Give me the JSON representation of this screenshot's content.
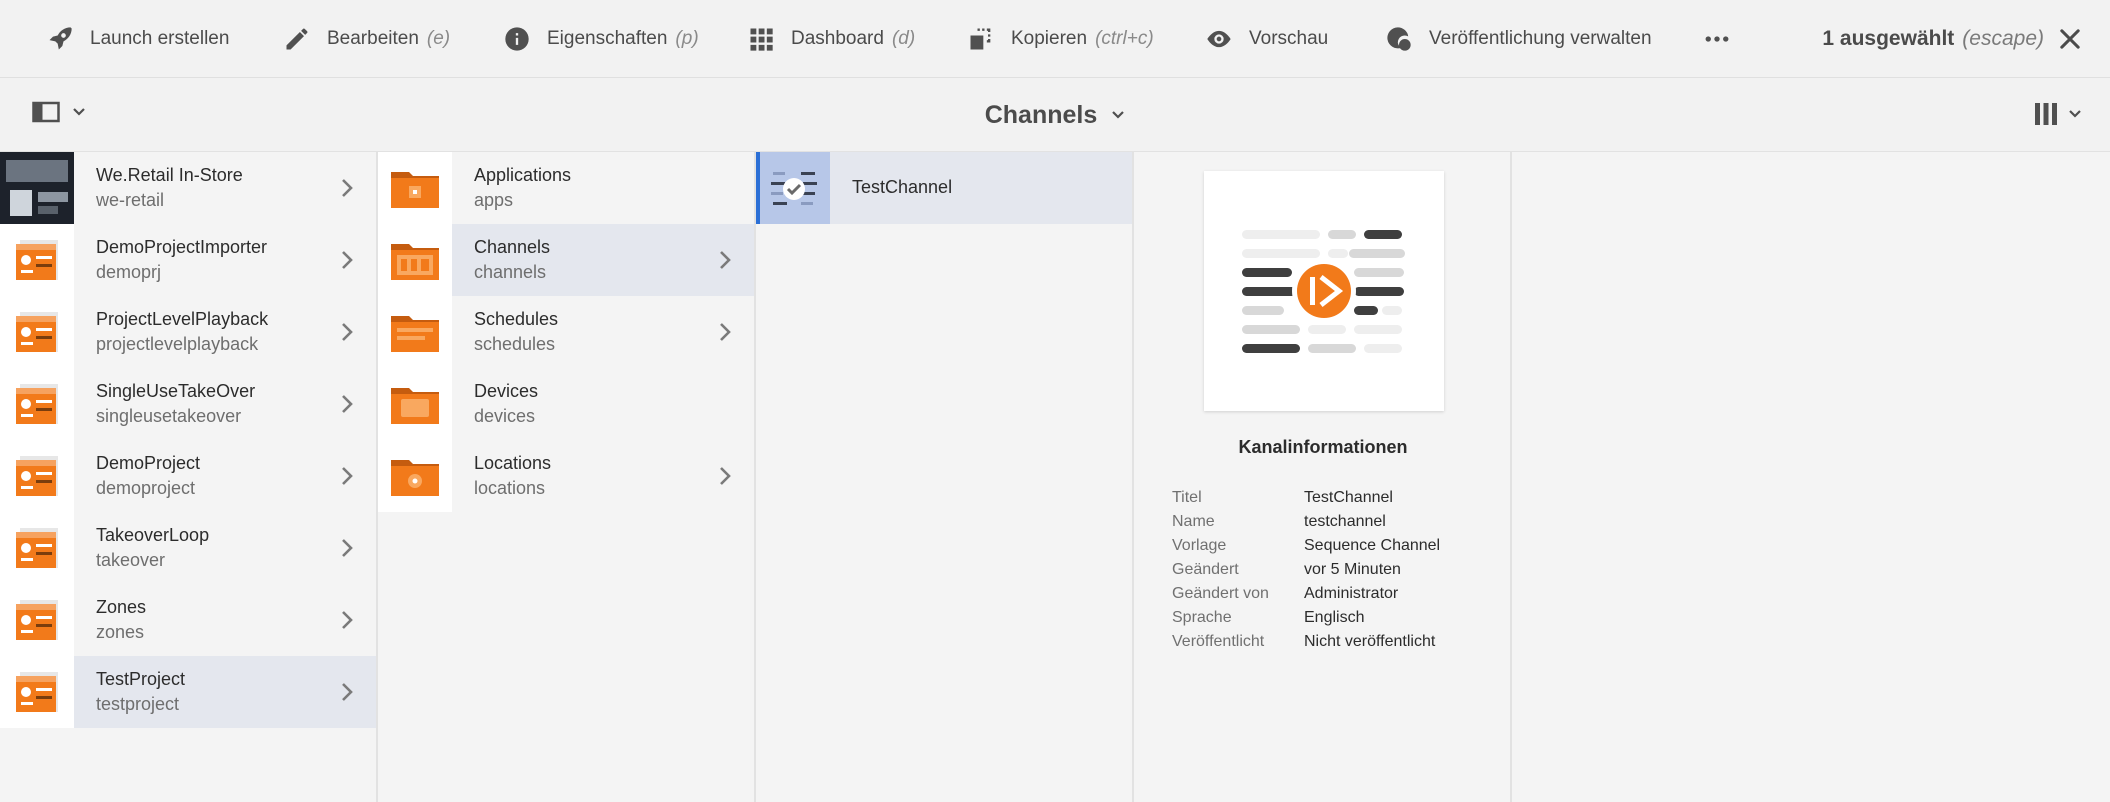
{
  "actionbar": {
    "actions": [
      {
        "label": "Launch erstellen",
        "kbd": ""
      },
      {
        "label": "Bearbeiten",
        "kbd": "(e)"
      },
      {
        "label": "Eigenschaften",
        "kbd": "(p)"
      },
      {
        "label": "Dashboard",
        "kbd": "(d)"
      },
      {
        "label": "Kopieren",
        "kbd": "(ctrl+c)"
      },
      {
        "label": "Vorschau",
        "kbd": ""
      },
      {
        "label": "Veröffentlichung verwalten",
        "kbd": ""
      }
    ],
    "more_icon": "more-horizontal-icon",
    "selection_label": "1 ausgewählt",
    "selection_kbd": "(escape)",
    "close_icon": "close-icon"
  },
  "header": {
    "title": "Channels",
    "rail_icon": "rail-toggle-icon",
    "view_icon": "column-view-icon"
  },
  "column1": [
    {
      "title": "We.Retail In-Store",
      "subtitle": "we-retail"
    },
    {
      "title": "DemoProjectImporter",
      "subtitle": "demoprj"
    },
    {
      "title": "ProjectLevelPlayback",
      "subtitle": "projectlevelplayback"
    },
    {
      "title": "SingleUseTakeOver",
      "subtitle": "singleusetakeover"
    },
    {
      "title": "DemoProject",
      "subtitle": "demoproject"
    },
    {
      "title": "TakeoverLoop",
      "subtitle": "takeover"
    },
    {
      "title": "Zones",
      "subtitle": "zones"
    },
    {
      "title": "TestProject",
      "subtitle": "testproject"
    }
  ],
  "column2": [
    {
      "title": "Applications",
      "subtitle": "apps"
    },
    {
      "title": "Channels",
      "subtitle": "channels"
    },
    {
      "title": "Schedules",
      "subtitle": "schedules"
    },
    {
      "title": "Devices",
      "subtitle": "devices"
    },
    {
      "title": "Locations",
      "subtitle": "locations"
    }
  ],
  "column3": [
    {
      "title": "TestChannel"
    }
  ],
  "info": {
    "heading": "Kanalinformationen",
    "rows": [
      {
        "key": "Titel",
        "value": "TestChannel"
      },
      {
        "key": "Name",
        "value": "testchannel"
      },
      {
        "key": "Vorlage",
        "value": "Sequence Channel"
      },
      {
        "key": "Geändert",
        "value": "vor 5 Minuten"
      },
      {
        "key": "Geändert von",
        "value": "Administrator"
      },
      {
        "key": "Sprache",
        "value": "Englisch"
      },
      {
        "key": "Veröffentlicht",
        "value": "Nicht veröffentlicht"
      }
    ]
  },
  "colors": {
    "accent_orange": "#f27a1a",
    "selection_bg": "#e4e7ee",
    "selection_bar": "#2b6fd6"
  }
}
